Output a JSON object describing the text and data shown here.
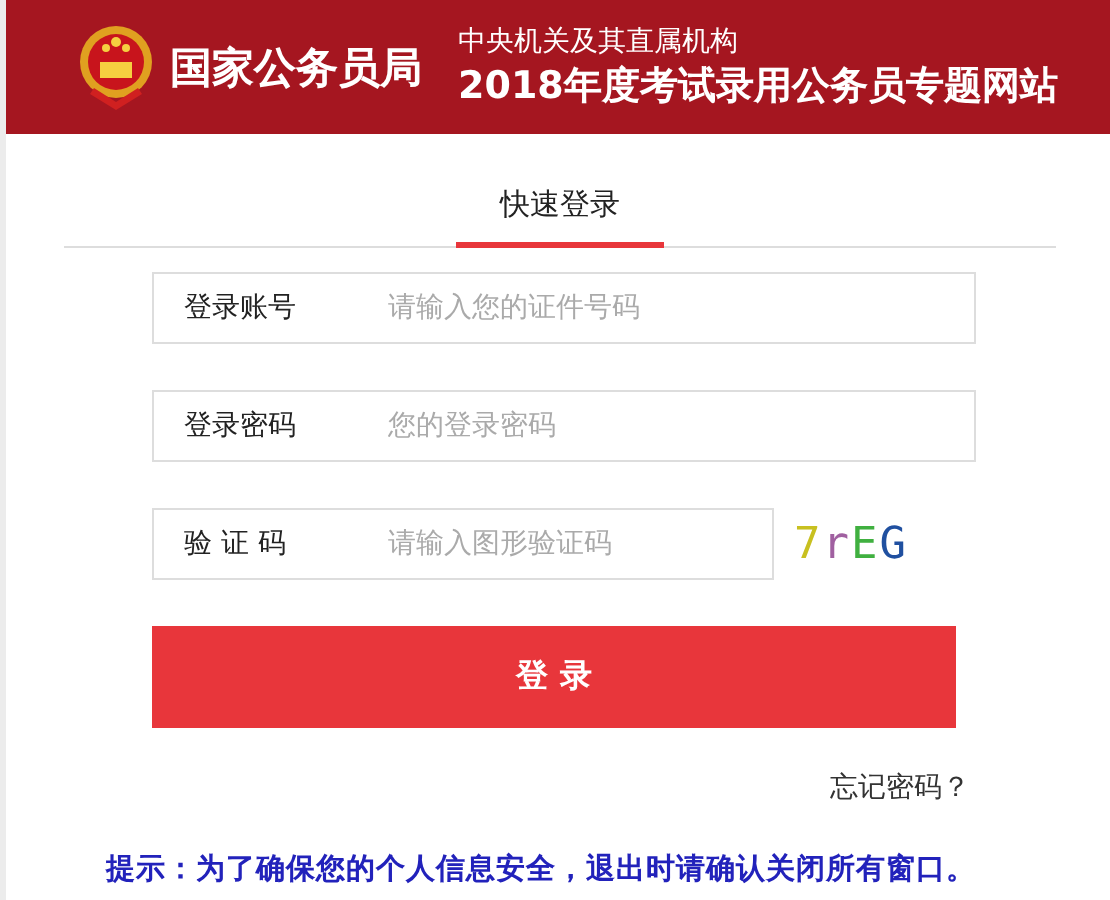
{
  "header": {
    "agency": "国家公务员局",
    "subtitle": "中央机关及其直属机构",
    "title": "2018年度考试录用公务员专题网站"
  },
  "tabs": [
    {
      "label": "快速登录",
      "selected": true
    }
  ],
  "fields": [
    {
      "label": "登录账号",
      "placeholder": "请输入您的证件号码",
      "kind": "text"
    },
    {
      "label": "登录密码",
      "placeholder": "您的登录密码",
      "kind": "password"
    },
    {
      "label": "验 证 码",
      "placeholder": "请输入图形验证码",
      "kind": "captcha"
    }
  ],
  "captcha": "7rEG",
  "login_button": "登 录",
  "forgot_link": "忘记密码？",
  "tip": "提示：为了确保您的个人信息安全，退出时请确认关闭所有窗口。"
}
